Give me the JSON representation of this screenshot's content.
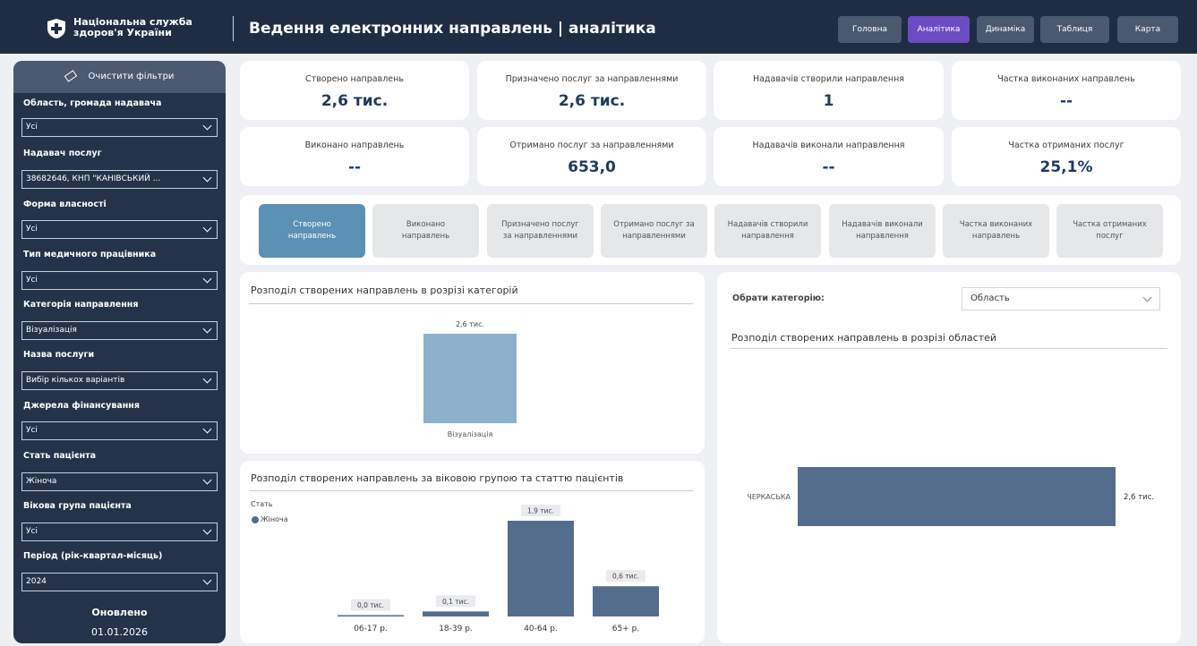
{
  "header": {
    "org_name": "Національна служба\nздоров'я України",
    "title": "Ведення електронних направлень | аналітика",
    "nav": [
      {
        "label": "Головна",
        "active": false
      },
      {
        "label": "Аналітика",
        "active": true
      },
      {
        "label": "Динаміка",
        "active": false
      },
      {
        "label": "Таблиця",
        "active": false
      },
      {
        "label": "Карта",
        "active": false
      }
    ]
  },
  "sidebar": {
    "clear_filters": "Очистити фільтри",
    "filters": [
      {
        "label": "Область, громада надавача",
        "value": "Усі"
      },
      {
        "label": "Надавач послуг",
        "value": "38682646, КНП \"КАНІВСЬКИЙ ..."
      },
      {
        "label": "Форма власності",
        "value": "Усі"
      },
      {
        "label": "Тип медичного працівника",
        "value": "Усі"
      },
      {
        "label": "Категорія направлення",
        "value": "Візуалізація"
      },
      {
        "label": "Назва послуги",
        "value": "Вибір кількох варіантів"
      },
      {
        "label": "Джерела фінансування",
        "value": "Усі"
      },
      {
        "label": "Стать пацієнта",
        "value": "Жіноча"
      },
      {
        "label": "Вікова група пацієнта",
        "value": "Усі"
      },
      {
        "label": "Період (рік-квартал-місяць)",
        "value": "2024"
      }
    ],
    "updated_label": "Оновлено",
    "updated_date": "01.01.2026"
  },
  "kpis": [
    {
      "label": "Створено направлень",
      "value": "2,6 тис."
    },
    {
      "label": "Призначено послуг за направленнями",
      "value": "2,6 тис."
    },
    {
      "label": "Надавачів створили направлення",
      "value": "1"
    },
    {
      "label": "Частка виконаних направлень",
      "value": "--"
    },
    {
      "label": "Виконано направлень",
      "value": "--"
    },
    {
      "label": "Отримано послуг за направленнями",
      "value": "653,0"
    },
    {
      "label": "Надавачів виконали направлення",
      "value": "--"
    },
    {
      "label": "Частка отриманих послуг",
      "value": "25,1%"
    }
  ],
  "metric_tabs": [
    {
      "label": "Створено\nнаправлень",
      "active": true
    },
    {
      "label": "Виконано\nнаправлень",
      "active": false
    },
    {
      "label": "Призначено послуг\nза направленнями",
      "active": false
    },
    {
      "label": "Отримано послуг за\nнаправленнями",
      "active": false
    },
    {
      "label": "Надавачів створили\nнаправлення",
      "active": false
    },
    {
      "label": "Надавачів виконали\nнаправлення",
      "active": false
    },
    {
      "label": "Частка виконаних\nнаправлень",
      "active": false
    },
    {
      "label": "Частка отриманих\nпослуг",
      "active": false
    }
  ],
  "category_picker": {
    "label": "Обрати категорію:",
    "selected": "Область"
  },
  "colors": {
    "header_bg": "#1f2d44",
    "accent_purple": "#6c4bc4",
    "active_tab": "#5b91b5",
    "bar_light": "#8fb0cc",
    "bar_dark": "#556d8c"
  },
  "chart_data": [
    {
      "type": "bar",
      "title": "Розподіл створених направлень в розрізі категорій",
      "categories": [
        "Візуалізація"
      ],
      "values": [
        2600
      ],
      "data_labels": [
        "2,6 тис."
      ]
    },
    {
      "type": "bar",
      "title": "Розподіл створених направлень за віковою групою та статтю пацієнтів",
      "legend_title": "Стать",
      "categories": [
        "06-17 р.",
        "18-39 р.",
        "40-64 р.",
        "65+ р."
      ],
      "series": [
        {
          "name": "Жіноча",
          "values": [
            0,
            100,
            1900,
            600
          ]
        }
      ],
      "data_labels": [
        "0,0 тис.",
        "0,1 тис.",
        "1,9 тис.",
        "0,6 тис."
      ]
    },
    {
      "type": "bar",
      "orientation": "horizontal",
      "title": "Розподіл створених направлень в розрізі областей",
      "categories": [
        "ЧЕРКАСЬКА"
      ],
      "values": [
        2600
      ],
      "data_labels": [
        "2,6 тис."
      ]
    }
  ]
}
